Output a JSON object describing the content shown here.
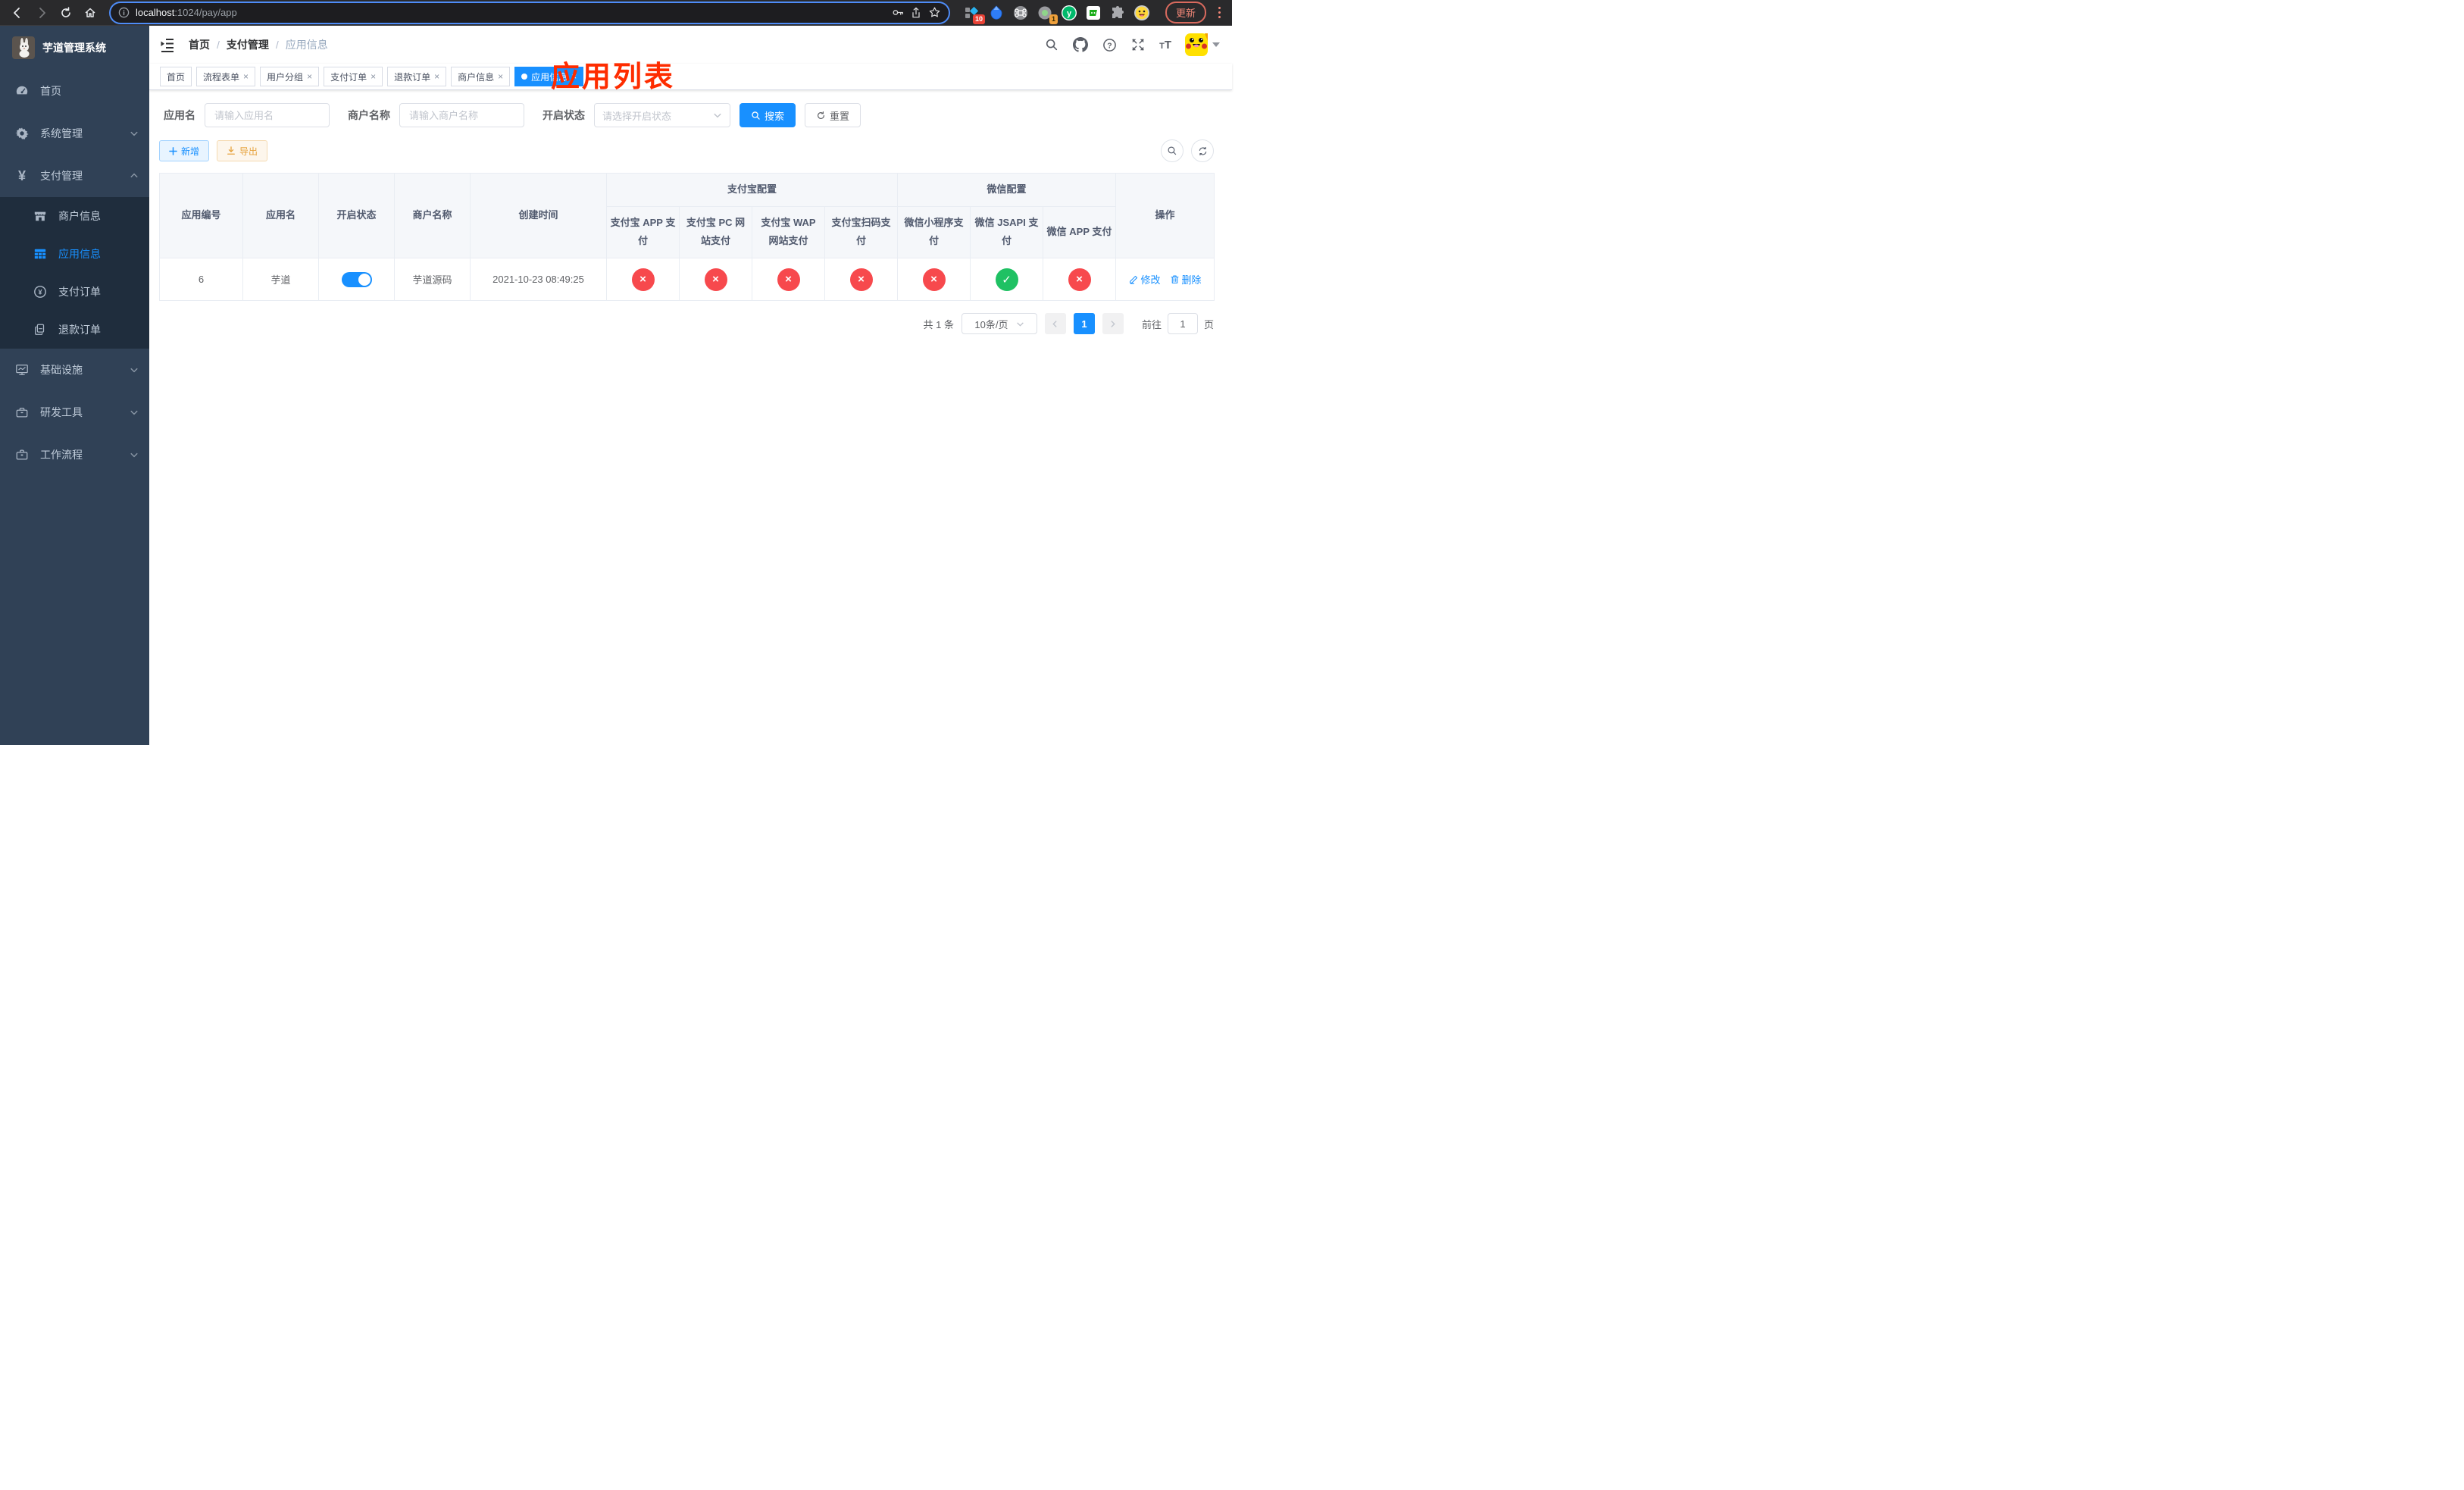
{
  "browser": {
    "url": {
      "host": "localhost",
      "rest": ":1024/pay/app"
    },
    "update_label": "更新",
    "ext_badge_bookmarks": "10",
    "ext_badge_timer": "1"
  },
  "sidebar": {
    "title": "芋道管理系统",
    "items": [
      {
        "label": "首页"
      },
      {
        "label": "系统管理"
      },
      {
        "label": "支付管理"
      },
      {
        "label": "商户信息"
      },
      {
        "label": "应用信息"
      },
      {
        "label": "支付订单"
      },
      {
        "label": "退款订单"
      },
      {
        "label": "基础设施"
      },
      {
        "label": "研发工具"
      },
      {
        "label": "工作流程"
      }
    ]
  },
  "header": {
    "breadcrumb": [
      "首页",
      "支付管理",
      "应用信息"
    ],
    "separator": "/",
    "annotation": "应用列表"
  },
  "tabs": [
    {
      "label": "首页",
      "closable": false,
      "active": false
    },
    {
      "label": "流程表单",
      "closable": true,
      "active": false
    },
    {
      "label": "用户分组",
      "closable": true,
      "active": false
    },
    {
      "label": "支付订单",
      "closable": true,
      "active": false
    },
    {
      "label": "退款订单",
      "closable": true,
      "active": false
    },
    {
      "label": "商户信息",
      "closable": true,
      "active": false
    },
    {
      "label": "应用信息",
      "closable": true,
      "active": true
    }
  ],
  "close_glyph": "×",
  "filters": {
    "app_name": {
      "label": "应用名",
      "placeholder": "请输入应用名"
    },
    "merchant_name": {
      "label": "商户名称",
      "placeholder": "请输入商户名称"
    },
    "status": {
      "label": "开启状态",
      "placeholder": "请选择开启状态"
    },
    "search_label": "搜索",
    "reset_label": "重置"
  },
  "toolbar": {
    "add_label": "新增",
    "export_label": "导出"
  },
  "table": {
    "columns": {
      "app_id": "应用编号",
      "app_name": "应用名",
      "status": "开启状态",
      "merchant": "商户名称",
      "created": "创建时间",
      "alipay_group": "支付宝配置",
      "wechat_group": "微信配置",
      "alipay_app": "支付宝 APP 支付",
      "alipay_pc": "支付宝 PC 网站支付",
      "alipay_wap": "支付宝 WAP 网站支付",
      "alipay_qr": "支付宝扫码支付",
      "wx_lite": "微信小程序支付",
      "wx_jsapi": "微信 JSAPI 支付",
      "wx_app": "微信 APP 支付",
      "actions": "操作"
    },
    "row": {
      "app_id": "6",
      "app_name": "芋道",
      "enabled": true,
      "merchant": "芋道源码",
      "created": "2021-10-23 08:49:25",
      "configs": [
        {
          "name": "alipay-app-pay",
          "on": false,
          "glyph": "×"
        },
        {
          "name": "alipay-pc-pay",
          "on": false,
          "glyph": "×"
        },
        {
          "name": "alipay-wap-pay",
          "on": false,
          "glyph": "×"
        },
        {
          "name": "alipay-qr-pay",
          "on": false,
          "glyph": "×"
        },
        {
          "name": "wechat-lite-pay",
          "on": false,
          "glyph": "×"
        },
        {
          "name": "wechat-jsapi-pay",
          "on": true,
          "glyph": "✓"
        },
        {
          "name": "wechat-app-pay",
          "on": false,
          "glyph": "×"
        }
      ],
      "edit_label": "修改",
      "delete_label": "删除"
    }
  },
  "pagination": {
    "total": "共 1 条",
    "page_size": "10条/页",
    "page": "1",
    "goto_label": "前往",
    "goto_value": "1",
    "page_suffix": "页"
  },
  "colors": {
    "accent": "#1890ff",
    "success": "#1fc163",
    "danger": "#f7494d",
    "warning": "#e6a23c",
    "sidebar_bg": "#304156",
    "submenu_bg": "#1f2d3d",
    "annotation": "#fe2c00"
  }
}
